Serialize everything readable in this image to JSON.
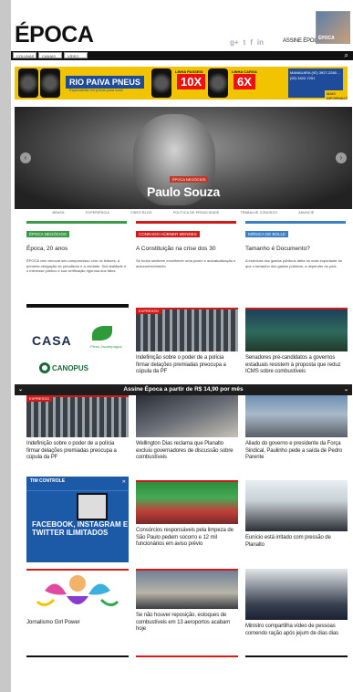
{
  "header": {
    "logo": "ÉPOCA",
    "social": [
      "g+",
      "t",
      "f",
      "in"
    ],
    "subscribe_link": "ASSINE ÉPOCA",
    "magazine_label": "ÉPOCA",
    "nav_tabs": [
      "COLUNAS",
      "CANAIS",
      "VÍDEO"
    ]
  },
  "ad_banner": {
    "brand": "RIO PAIVA PNEUS",
    "brand_sub": "Especialista em pneus para você",
    "offer1_tag": "LINHA PASSEIO",
    "offer1": "10X",
    "offer2_tag": "LINHA CARGA",
    "offer2": "6X",
    "contact": "MANAUARA (92) 3927-2280 ... (92) 3422-7251",
    "cta": "MAIS INFORMAÇÕES"
  },
  "hero": {
    "tag": "ÉPOCA NEGÓCIOS",
    "title": "Paulo Souza",
    "prev_label": "‹",
    "next_label": "›",
    "nav": [
      "BRASIL",
      "EXPERIÊNCIA",
      "VIDEO BLOG",
      "POLÍTICA DE PRIVACIDADE",
      "TRABALHE CONOSCO",
      "ANUNCIE"
    ]
  },
  "text_cards": [
    {
      "tag": "ÉPOCA NEGÓCIOS",
      "color": "#3a9a4a",
      "title": "Época, 20 anos",
      "desc": "ÉPOCA vem renovar seu compromisso com os leitores. A primeira obrigação do jornalismo é a verdade. Sua lealdade é o interesse público e sua verificação rigorosa dos fatos."
    },
    {
      "tag": "CONRADO HÜBNER MENDES",
      "color": "#d01b1b",
      "title": "A Constituição na crise dos 30",
      "desc": "Se todos sentirem envelhecer uma jovem e autoatualização e autoconhecimento"
    },
    {
      "tag": "MÔNICA DE BOLLE",
      "color": "#3b7fc4",
      "title": "Tamanho é Documento?",
      "desc": "A estrutura dos gastos públicos afeta os mais importante do que o tamanho dos gastos públicos, a depender do país"
    }
  ],
  "ad_casa": {
    "brand": "CASA",
    "sub": "SHOPPING",
    "leaf": "Pleno Jacarepaguá",
    "partner": "CANOPUS"
  },
  "cards": [
    {
      "id": "c1",
      "ribbon": "EXPRESSO",
      "caption": "Indefinição sobre o poder de a polícia firmar delações premiadas preocupa a cúpula da PF"
    },
    {
      "id": "c2",
      "caption": "Senadores pré-candidatos a governos estaduais resistem à proposta que reduz ICMS sobre combustíveis"
    },
    {
      "id": "c3",
      "ribbon": "EXPRESSO",
      "caption": "Indefinição sobre o poder de a polícia firmar delações premiadas preocupa a cúpula da PF"
    },
    {
      "id": "c4",
      "caption": "Wellington Dias reclama que Planalto excluiu governadores de discussão sobre combustíveis"
    },
    {
      "id": "c5",
      "caption": "Aliado do governo e presidente da Força Sindical, Paulinho pede a saída de Pedro Parente"
    },
    {
      "id": "c6",
      "caption": "Consórcios responsáveis pela limpeza de São Paulo pedem socorro e 12 mil funcionários em aviso prévio"
    },
    {
      "id": "c7",
      "caption": "Eunício está irritado com pressão de Planalto"
    },
    {
      "id": "c8",
      "caption": "Se não houver reposição, estoques de combustíveis em 13 aeroportos acabam hoje"
    },
    {
      "id": "c9",
      "caption": "Ministro compartilha vídeo de pessoas comendo ração após jejum de dias dias"
    }
  ],
  "subscribe_bar": {
    "text": "Assine Época a partir de R$ 14,90 por mês",
    "left": "⌄",
    "right": "⌄"
  },
  "ad_tim": {
    "logo": "TIM CONTROLE",
    "text": "FACEBOOK, INSTAGRAM E TWITTER ILIMITADOS",
    "close": "✕"
  },
  "art_card": {
    "caption": "Jornalismo Girl Power"
  }
}
